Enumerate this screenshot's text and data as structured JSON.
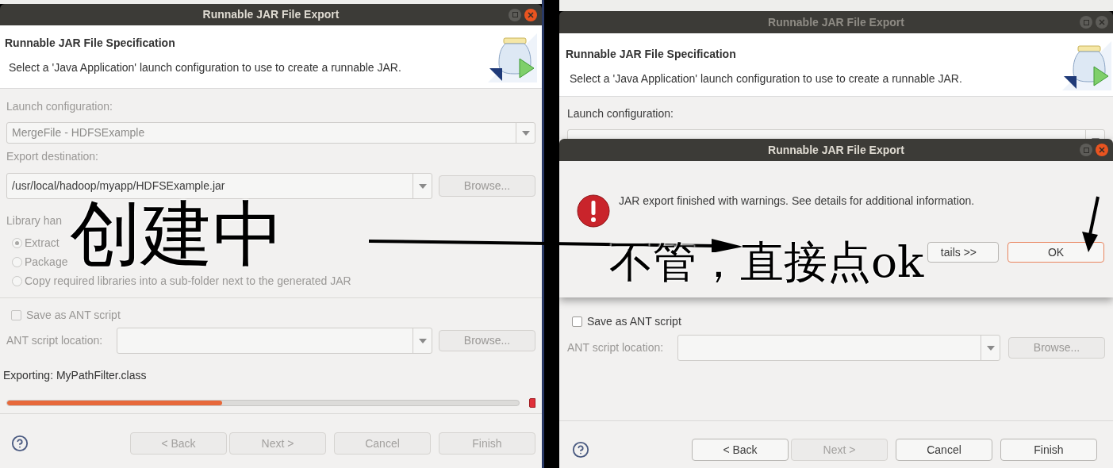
{
  "left_dialog": {
    "title": "Runnable JAR File Export",
    "header_title": "Runnable JAR File Specification",
    "header_description": "Select a 'Java Application' launch configuration to use to create a runnable JAR.",
    "launch_label": "Launch configuration:",
    "launch_value": "MergeFile - HDFSExample",
    "destination_label": "Export destination:",
    "destination_value": "/usr/local/hadoop/myapp/HDFSExample.jar",
    "destination_browse": "Browse...",
    "library_label": "Library han",
    "radios": [
      {
        "parts": [
          "Extract"
        ],
        "selected": true
      },
      {
        "parts": [
          "Package"
        ],
        "selected": false
      },
      {
        "parts": [
          "Copy required libraries into a sub-folder next to the generated JAR"
        ],
        "selected": false
      }
    ],
    "save_ant": {
      "label": "Save as ANT script",
      "checked": false
    },
    "ant_label": "ANT script location:",
    "ant_browse": "Browse...",
    "status": "Exporting: MyPathFilter.class",
    "progress": {
      "level": 0.42
    },
    "buttons": [
      {
        "label": "< Back",
        "disabled": true
      },
      {
        "label": "Next >",
        "disabled": true
      },
      {
        "label": "Cancel",
        "disabled": true
      },
      {
        "label": "Finish",
        "disabled": true
      }
    ]
  },
  "right_dialog": {
    "title": "Runnable JAR File Export",
    "header_title": "Runnable JAR File Specification",
    "header_description": "Select a 'Java Application' launch configuration to use to create a runnable JAR.",
    "launch_label": "Launch configuration:",
    "save_ant": {
      "label": "Save as ANT script",
      "checked": false
    },
    "ant_label": "ANT script location:",
    "ant_browse": "Browse...",
    "buttons": [
      {
        "label": "< Back",
        "disabled": false
      },
      {
        "label": "Next >",
        "disabled": true
      },
      {
        "label": "Cancel",
        "disabled": false
      },
      {
        "label": "Finish",
        "disabled": false
      }
    ]
  },
  "message_dialog": {
    "title": "Runnable JAR File Export",
    "message": "JAR export finished with warnings. See details for additional information.",
    "buttons": [
      {
        "label": "tails >>",
        "kind": "normal"
      },
      {
        "label": "OK",
        "kind": "default"
      }
    ]
  },
  "annotations": [
    {
      "text": "创建中"
    },
    {
      "text": "不管，直接点ok"
    }
  ]
}
